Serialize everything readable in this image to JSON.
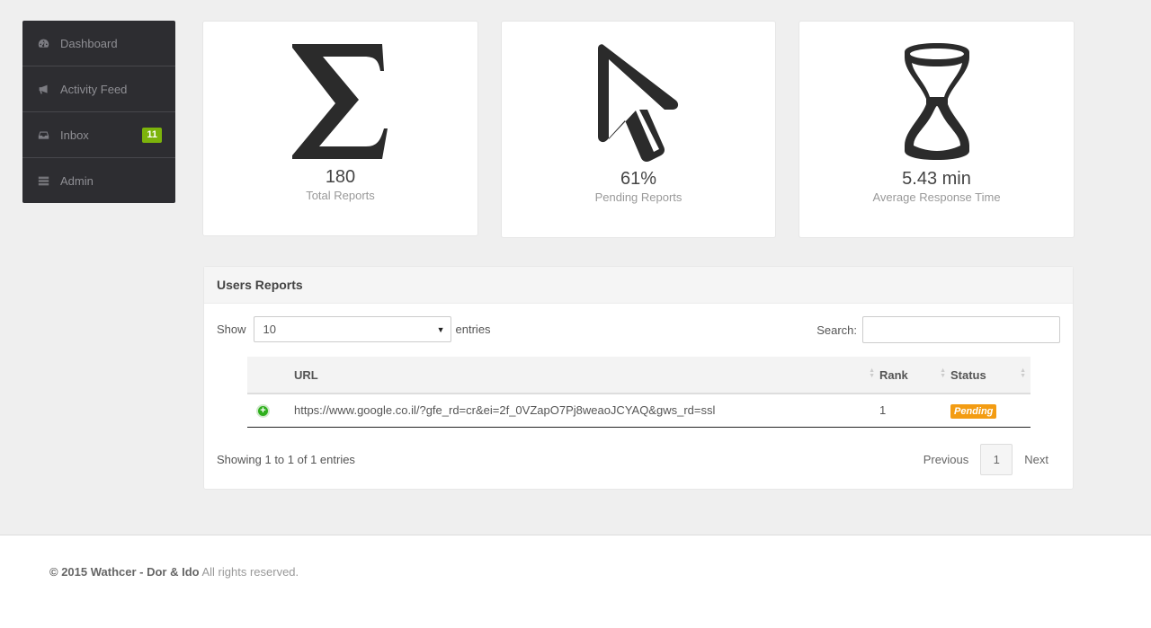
{
  "sidebar": {
    "items": [
      {
        "label": "Dashboard",
        "icon": "dashboard-icon"
      },
      {
        "label": "Activity Feed",
        "icon": "megaphone-icon"
      },
      {
        "label": "Inbox",
        "icon": "inbox-icon",
        "badge": "11"
      },
      {
        "label": "Admin",
        "icon": "list-icon"
      }
    ],
    "badge_color": "#7cb30b"
  },
  "stats": [
    {
      "icon": "sigma-icon",
      "value": "180",
      "label": "Total Reports"
    },
    {
      "icon": "cursor-icon",
      "value": "61%",
      "label": "Pending Reports"
    },
    {
      "icon": "hourglass-icon",
      "value": "5.43 min",
      "label": "Average Response Time"
    }
  ],
  "panel": {
    "title": "Users Reports",
    "show_label": "Show",
    "entries_value": "10",
    "entries_label": "entries",
    "search_label": "Search:",
    "search_value": "",
    "columns": [
      "URL",
      "Rank",
      "Status"
    ],
    "rows": [
      {
        "url": "https://www.google.co.il/?gfe_rd=cr&ei=2f_0VZapO7Pj8weaoJCYAQ&gws_rd=ssl",
        "rank": "1",
        "status": "Pending"
      }
    ],
    "info": "Showing 1 to 1 of 1 entries",
    "pager": {
      "previous": "Previous",
      "current": "1",
      "next": "Next"
    },
    "status_color": "#f39c12"
  },
  "footer": {
    "copyright": "© 2015 Wathcer - Dor & Ido",
    "rights": "All rights reserved."
  }
}
